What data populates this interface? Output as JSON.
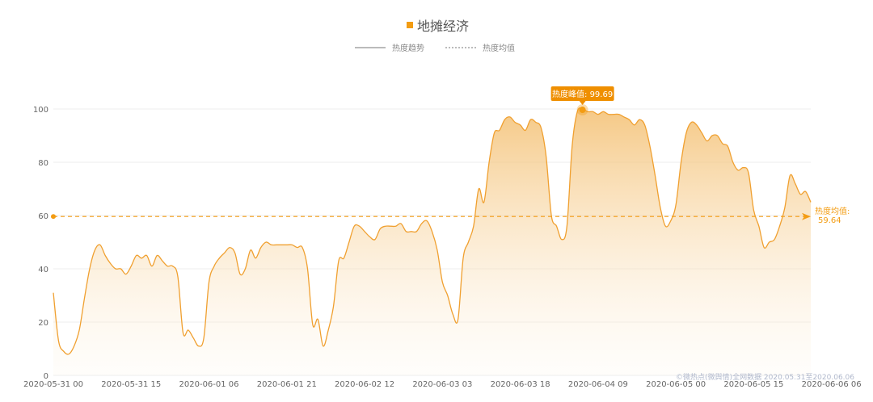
{
  "colors": {
    "line": "#f0a030",
    "accent": "#f39c12",
    "tooltip_bg": "#ef8f00",
    "axis_text": "#666666",
    "grid": "#eeeeee",
    "legend_text": "#888888",
    "title_text": "#555555",
    "watermark": "#b0b8cc"
  },
  "chart_data": {
    "type": "area",
    "title": "地摊经济",
    "legend": [
      {
        "name": "热度趋势",
        "style": "solid"
      },
      {
        "name": "热度均值",
        "style": "dashed"
      }
    ],
    "x_tick_labels": [
      "2020-05-31 00",
      "2020-05-31 15",
      "2020-06-01 06",
      "2020-06-01 21",
      "2020-06-02 12",
      "2020-06-03 03",
      "2020-06-03 18",
      "2020-06-04 09",
      "2020-06-05 00",
      "2020-06-05 15",
      "2020-06-06 06"
    ],
    "x_start": "2020-05-31 00:00",
    "x_step_hours": 1,
    "ylim": [
      0,
      100
    ],
    "y_ticks": [
      0,
      20,
      40,
      60,
      80,
      100
    ],
    "grid": true,
    "series": [
      {
        "name": "热度趋势",
        "values": [
          31,
          13,
          9,
          8,
          11,
          17,
          29,
          40,
          47,
          49,
          45,
          42,
          40,
          40,
          38,
          41,
          45,
          44,
          45,
          41,
          45,
          43,
          41,
          41,
          37,
          16,
          17,
          14,
          11,
          14,
          35,
          41,
          44,
          46,
          48,
          46,
          38,
          40,
          47,
          44,
          48,
          50,
          49,
          49,
          49,
          49,
          49,
          48,
          48,
          40,
          19,
          21,
          11,
          17,
          26,
          43,
          44,
          50,
          56,
          56,
          54,
          52,
          51,
          55,
          56,
          56,
          56,
          57,
          54,
          54,
          54,
          57,
          58,
          54,
          47,
          35,
          30,
          23,
          21,
          44,
          50,
          56,
          70,
          65,
          80,
          91,
          92,
          96,
          97,
          95,
          94,
          92,
          96,
          95,
          93,
          82,
          60,
          56,
          51,
          56,
          86,
          99,
          100,
          99,
          99,
          98,
          99,
          98,
          98,
          98,
          97,
          96,
          94,
          96,
          94,
          86,
          75,
          63,
          56,
          58,
          64,
          80,
          91,
          95,
          94,
          91,
          88,
          90,
          90,
          87,
          86,
          80,
          77,
          78,
          76,
          62,
          56,
          48,
          50,
          51,
          56,
          63,
          75,
          72,
          68,
          69,
          65
        ]
      }
    ],
    "average": {
      "label": "热度均值:",
      "value": 59.64
    },
    "peak": {
      "label": "热度峰值:",
      "value": 99.69,
      "time": "2020-06-04 10:00"
    },
    "watermark": "©微热点(微舆情)全网数据 2020.05.31至2020.06.06"
  }
}
